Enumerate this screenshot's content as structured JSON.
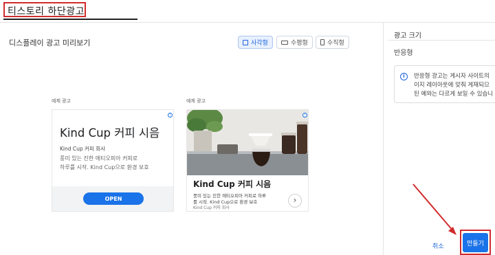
{
  "header": {
    "title": "티스토리 하단광고"
  },
  "preview": {
    "title": "디스플레이 광고 미리보기",
    "shapes": [
      {
        "label": "사각형",
        "icon": "square-icon",
        "selected": true
      },
      {
        "label": "수평형",
        "icon": "horizontal-rect-icon",
        "selected": false
      },
      {
        "label": "수직형",
        "icon": "vertical-rect-icon",
        "selected": false
      }
    ]
  },
  "ads": [
    {
      "label": "예제 광고",
      "headline": "Kind Cup 커피 시음",
      "advertiser": "Kind Cup 커피 회사",
      "desc_lines": [
        "풍미 있는 진한 에티오피아 커피로",
        "하루를 시작. Kind Cup으로 환경 보호"
      ],
      "cta": "OPEN"
    },
    {
      "label": "예제 광고",
      "headline": "Kind Cup 커피 시음",
      "desc_lines": [
        "풍미 있는 진한 에티오피아 커피로 하루",
        "를 시작. Kind Cup으로 환경 보호"
      ],
      "advertiser": "Kind Cup 커피 회사"
    }
  ],
  "panel": {
    "title": "광고 크기",
    "size_option": "반응형",
    "info_lines": [
      "반응형 광고는 게시자 사이트의",
      "이지 레이아웃에 맞춰 게재되므",
      "된 예와는 다르게 보일 수 있습니"
    ]
  },
  "footer": {
    "cancel": "취소",
    "create": "만들기"
  },
  "colors": {
    "accent": "#1a73e8",
    "annotation": "#d12b2b"
  }
}
